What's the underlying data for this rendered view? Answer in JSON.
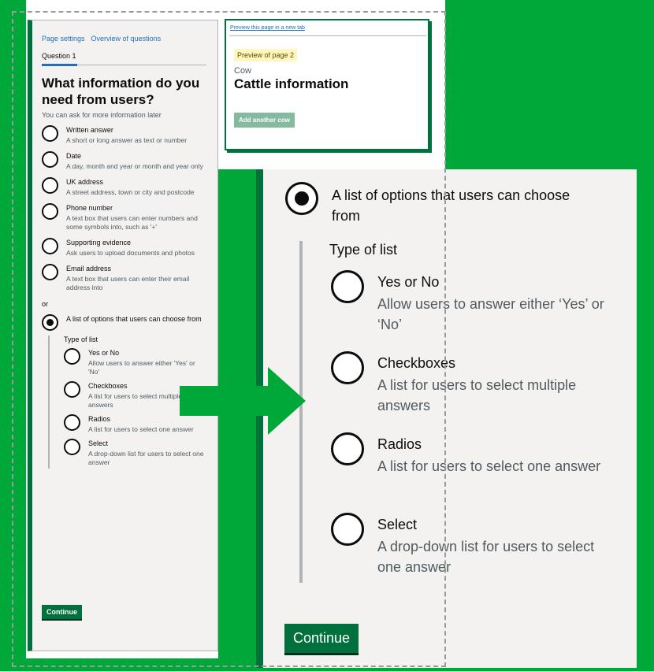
{
  "left_panel": {
    "nav": [
      "Page settings",
      "Overview of questions"
    ],
    "tab": "Question 1",
    "heading": "What information do you need from users?",
    "hint": "You can ask for more information later",
    "options": [
      {
        "label": "Written answer",
        "hint": "A short or long answer as text or number"
      },
      {
        "label": "Date",
        "hint": "A day, month and year or month and year only"
      },
      {
        "label": "UK address",
        "hint": "A street address, town or city and postcode"
      },
      {
        "label": "Phone number",
        "hint": "A text box that users can enter numbers and some symbols into, such as '+'"
      },
      {
        "label": "Supporting evidence",
        "hint": "Ask users to upload documents and photos"
      },
      {
        "label": "Email address",
        "hint": "A text box that users can enter their email address into"
      }
    ],
    "or": "or",
    "list_option": "A list of options that users can choose from",
    "type_of_list": "Type of list",
    "sub_options": [
      {
        "label": "Yes or No",
        "hint": "Allow users to answer either 'Yes' or 'No'"
      },
      {
        "label": "Checkboxes",
        "hint": "A list for users to select multiple answers"
      },
      {
        "label": "Radios",
        "hint": "A list for users to select one answer"
      },
      {
        "label": "Select",
        "hint": "A drop-down list for users to select one answer"
      }
    ],
    "continue": "Continue"
  },
  "preview": {
    "link": "Preview this page in a new tab",
    "tag": "Preview of page 2",
    "caption": "Cow",
    "title": "Cattle information",
    "button": "Add another cow"
  },
  "zoom": {
    "list_option": "A list of options that users can choose from",
    "type_of_list": "Type of list",
    "sub_options": [
      {
        "label": "Yes or No",
        "hint": "Allow users to answer either ‘Yes’ or ‘No’"
      },
      {
        "label": "Checkboxes",
        "hint": "A list for users to select multiple answers"
      },
      {
        "label": "Radios",
        "hint": "A list for users to select one answer"
      },
      {
        "label": "Select",
        "hint": "A drop-down list for users to select one answer"
      }
    ],
    "continue": "Continue"
  },
  "colors": {
    "accent_green": "#00a83a",
    "govuk_green": "#00703c",
    "link_blue": "#1d70b8"
  }
}
